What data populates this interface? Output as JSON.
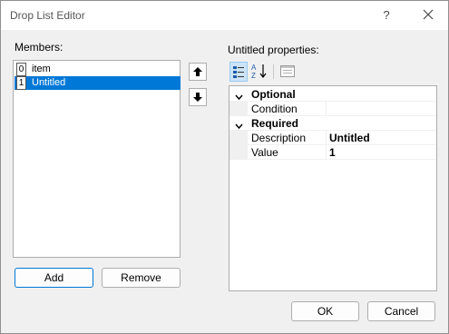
{
  "dialog": {
    "title": "Drop List Editor",
    "help_glyph": "?"
  },
  "members": {
    "label": "Members:",
    "items": [
      {
        "index": "0",
        "label": "item",
        "selected": false
      },
      {
        "index": "1",
        "label": "Untitled",
        "selected": true
      }
    ],
    "add_label": "Add",
    "remove_label": "Remove"
  },
  "properties": {
    "label": "Untitled properties:",
    "categories": [
      {
        "name": "Optional",
        "props": [
          {
            "name": "Condition",
            "value": ""
          }
        ]
      },
      {
        "name": "Required",
        "props": [
          {
            "name": "Description",
            "value": "Untitled"
          },
          {
            "name": "Value",
            "value": "1"
          }
        ]
      }
    ]
  },
  "footer": {
    "ok_label": "OK",
    "cancel_label": "Cancel"
  },
  "colors": {
    "selection": "#0078d7",
    "accent_border": "#0078d7"
  },
  "icons": [
    "close-icon",
    "arrow-up-icon",
    "arrow-down-icon",
    "categorized-icon",
    "alphabetical-icon",
    "property-pages-icon",
    "chevron-down-icon"
  ]
}
